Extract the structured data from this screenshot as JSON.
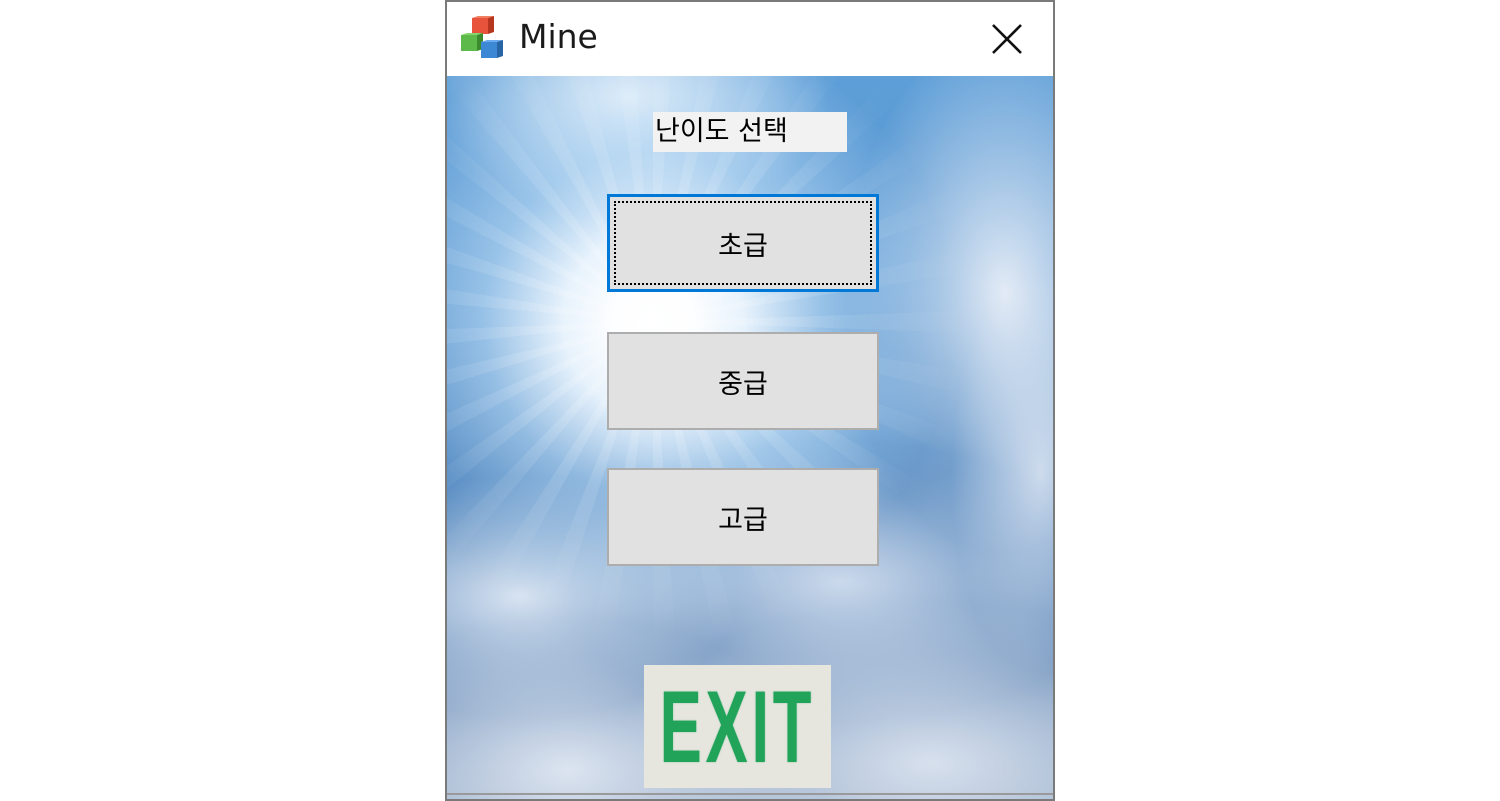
{
  "window": {
    "title": "Mine",
    "app_icon": "colored-cubes-icon",
    "close_icon": "close-icon"
  },
  "main": {
    "difficulty_label": "난이도 선택",
    "buttons": {
      "easy": "초급",
      "medium": "중급",
      "hard": "고급"
    },
    "exit_label": "EXIT"
  },
  "colors": {
    "focus_border": "#0078d7",
    "button_face": "#e1e1e1",
    "exit_green": "#22a35a"
  }
}
